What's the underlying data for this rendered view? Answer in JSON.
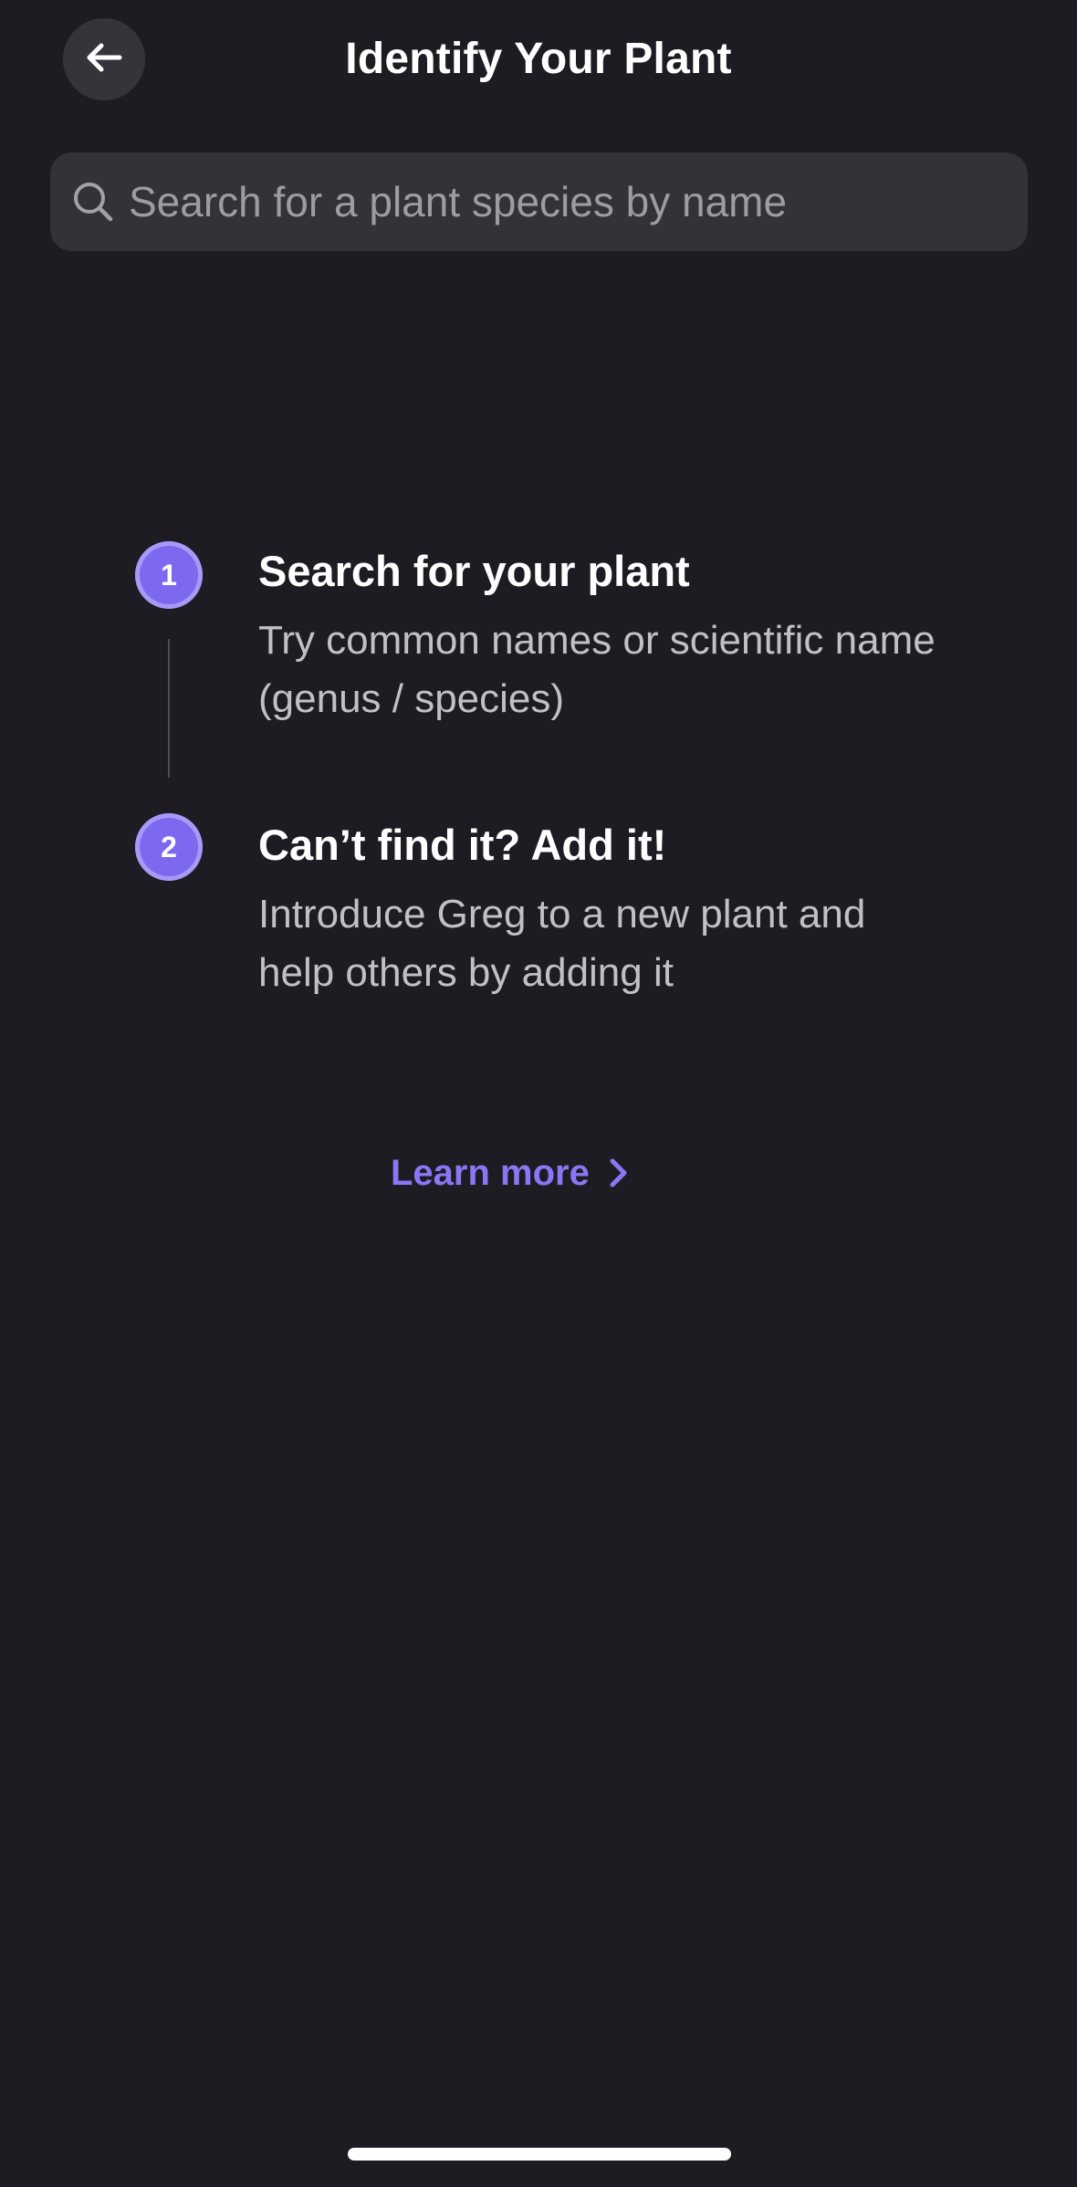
{
  "header": {
    "title": "Identify Your Plant",
    "back_icon": "arrow-left-icon"
  },
  "search": {
    "placeholder": "Search for a plant species by name",
    "value": "",
    "icon": "search-icon"
  },
  "steps": [
    {
      "number": "1",
      "title": "Search for your plant",
      "description": "Try common names or scientific name (genus / species)"
    },
    {
      "number": "2",
      "title": "Can’t find it? Add it!",
      "description": "Introduce Greg to a new plant and help others by adding it"
    }
  ],
  "learn_more": {
    "label": "Learn more",
    "icon": "chevron-right-icon"
  },
  "colors": {
    "background": "#1e1b22",
    "surface": "#343139",
    "accent": "#7d68f0",
    "link": "#8b77f5"
  }
}
